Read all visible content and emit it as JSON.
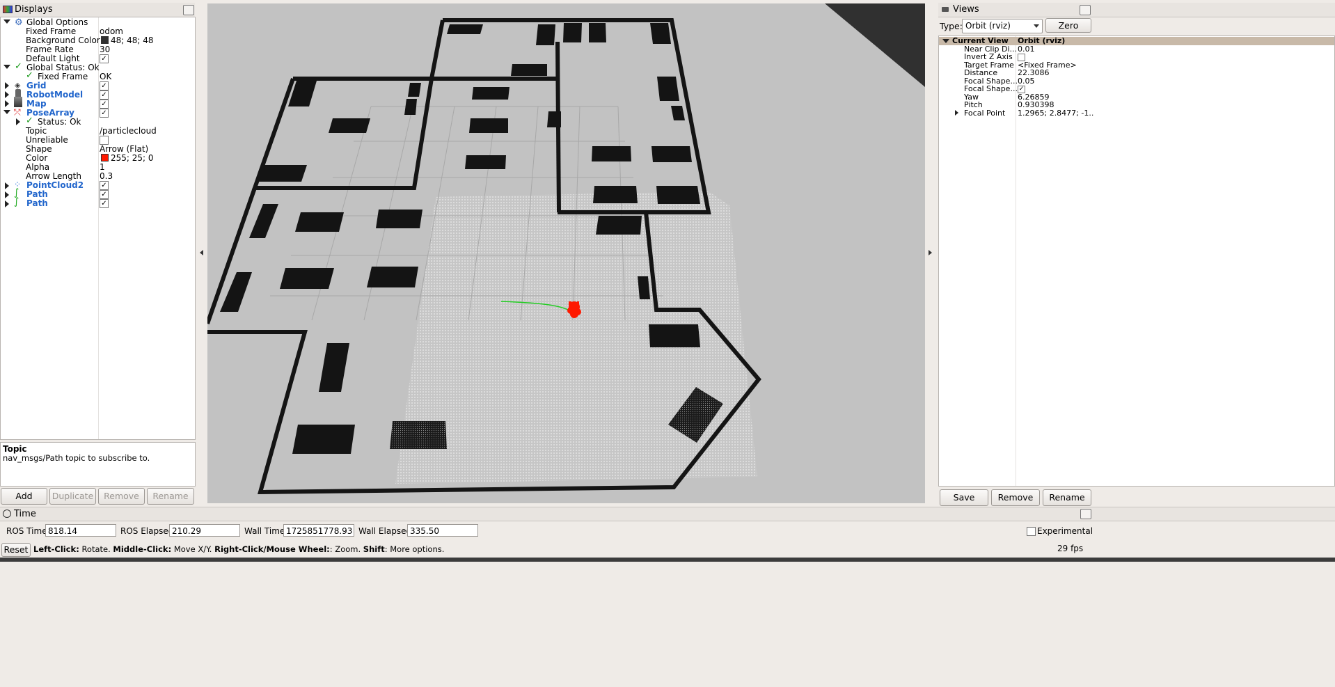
{
  "displays": {
    "title": "Displays",
    "rows": [
      {
        "label": "Global Options",
        "value": ""
      },
      {
        "label": "Fixed Frame",
        "value": "odom"
      },
      {
        "label": "Background Color",
        "value": "48; 48; 48",
        "swatch": "#303030"
      },
      {
        "label": "Frame Rate",
        "value": "30"
      },
      {
        "label": "Default Light",
        "value": ""
      },
      {
        "label": "Global Status: Ok",
        "value": ""
      },
      {
        "label": "Fixed Frame",
        "value": "OK"
      },
      {
        "label": "Grid",
        "value": ""
      },
      {
        "label": "RobotModel",
        "value": ""
      },
      {
        "label": "Map",
        "value": ""
      },
      {
        "label": "PoseArray",
        "value": ""
      },
      {
        "label": "Status: Ok",
        "value": ""
      },
      {
        "label": "Topic",
        "value": "/particlecloud"
      },
      {
        "label": "Unreliable",
        "value": ""
      },
      {
        "label": "Shape",
        "value": "Arrow (Flat)"
      },
      {
        "label": "Color",
        "value": "255; 25; 0",
        "swatch": "#ff1900"
      },
      {
        "label": "Alpha",
        "value": "1"
      },
      {
        "label": "Arrow Length",
        "value": "0.3"
      },
      {
        "label": "PointCloud2",
        "value": ""
      },
      {
        "label": "Path",
        "value": ""
      },
      {
        "label": "Path",
        "value": ""
      }
    ],
    "description_title": "Topic",
    "description_text": "nav_msgs/Path topic to subscribe to.",
    "buttons": {
      "add": "Add",
      "duplicate": "Duplicate",
      "remove": "Remove",
      "rename": "Rename"
    }
  },
  "views": {
    "title": "Views",
    "type_label": "Type:",
    "type_value": "Orbit (rviz)",
    "zero": "Zero",
    "rows": [
      {
        "label": "Current View",
        "value": "Orbit (rviz)"
      },
      {
        "label": "Near Clip Di...",
        "value": "0.01"
      },
      {
        "label": "Invert Z Axis",
        "value": ""
      },
      {
        "label": "Target Frame",
        "value": "<Fixed Frame>"
      },
      {
        "label": "Distance",
        "value": "22.3086"
      },
      {
        "label": "Focal Shape...",
        "value": "0.05"
      },
      {
        "label": "Focal Shape...",
        "value": ""
      },
      {
        "label": "Yaw",
        "value": "6.26859"
      },
      {
        "label": "Pitch",
        "value": "0.930398"
      },
      {
        "label": "Focal Point",
        "value": "1.2965; 2.8477; -1...."
      }
    ],
    "buttons": {
      "save": "Save",
      "remove": "Remove",
      "rename": "Rename"
    }
  },
  "time": {
    "title": "Time",
    "ros_time_label": "ROS Time:",
    "ros_time": "818.14",
    "ros_elapsed_label": "ROS Elapsed:",
    "ros_elapsed": "210.29",
    "wall_time_label": "Wall Time:",
    "wall_time": "1725851778.93",
    "wall_elapsed_label": "Wall Elapsed:",
    "wall_elapsed": "335.50",
    "experimental": "Experimental"
  },
  "status": {
    "reset": "Reset",
    "hint_b1": "Left-Click:",
    "hint_t1": " Rotate. ",
    "hint_b2": "Middle-Click:",
    "hint_t2": " Move X/Y. ",
    "hint_b3": "Right-Click/Mouse Wheel:",
    "hint_t3": ": Zoom. ",
    "hint_b4": "Shift",
    "hint_t4": ": More options.",
    "fps": "29 fps"
  },
  "colors": {
    "viewport_bg": "#c2c2c2",
    "wall": "#141414",
    "particles": "#ff1900",
    "path": "#22cc22"
  }
}
